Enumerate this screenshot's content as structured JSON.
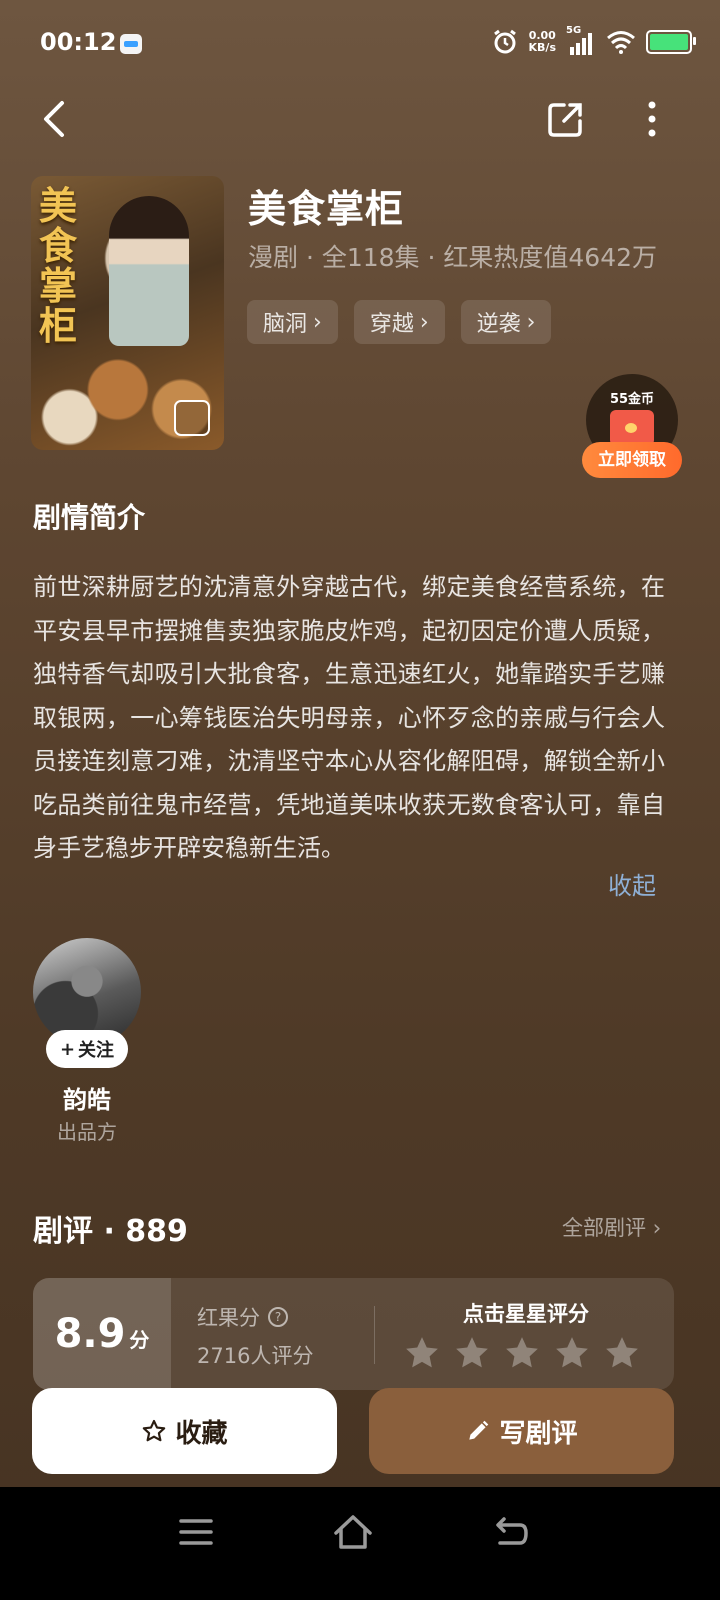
{
  "status_bar": {
    "time": "00:12",
    "speed_value": "0.00",
    "speed_unit": "KB/s",
    "network": "5G",
    "battery_level": 0.9,
    "colors": {
      "battery": "#47e27a"
    }
  },
  "header": {
    "back_icon": "back-arrow-icon",
    "share_icon": "share-icon",
    "more_icon": "more-vertical-icon"
  },
  "show": {
    "cover_title": "美食掌柜",
    "title": "美食掌柜",
    "meta": "漫剧 · 全118集 · 红果热度值4642万",
    "tags": [
      {
        "label": "脑洞"
      },
      {
        "label": "穿越"
      },
      {
        "label": "逆袭"
      }
    ]
  },
  "reward": {
    "coins": "55金币",
    "button": "立即领取",
    "colors": {
      "button": "#ff7a34",
      "envelope": "#f15a48"
    }
  },
  "synopsis": {
    "title": "剧情简介",
    "text": "前世深耕厨艺的沈清意外穿越古代，绑定美食经营系统，在平安县早市摆摊售卖独家脆皮炸鸡，起初因定价遭人质疑，独特香气却吸引大批食客，生意迅速红火，她靠踏实手艺赚取银两，一心筹钱医治失明母亲，心怀歹念的亲戚与行会人员接连刻意刁难，沈清坚守本心从容化解阻碍，解锁全新小吃品类前往鬼市经营，凭地道美味收获无数食客认可，靠自身手艺稳步开辟安稳新生活。",
    "collapse_label": "收起"
  },
  "producer": {
    "follow_label": "关注",
    "name": "韵皓",
    "role": "出品方"
  },
  "reviews": {
    "title": "剧评 · 889",
    "all_label": "全部剧评",
    "score": "8.9",
    "score_unit": "分",
    "score_label": "红果分",
    "rating_count": "2716人评分",
    "rate_prompt": "点击星星评分",
    "stars_total": 5
  },
  "actions": {
    "collect_label": "收藏",
    "review_label": "写剧评",
    "colors": {
      "review_button": "#8a5f3c"
    }
  },
  "system_nav": {
    "menu_icon": "menu-icon",
    "home_icon": "home-icon",
    "back_icon": "back-icon"
  }
}
